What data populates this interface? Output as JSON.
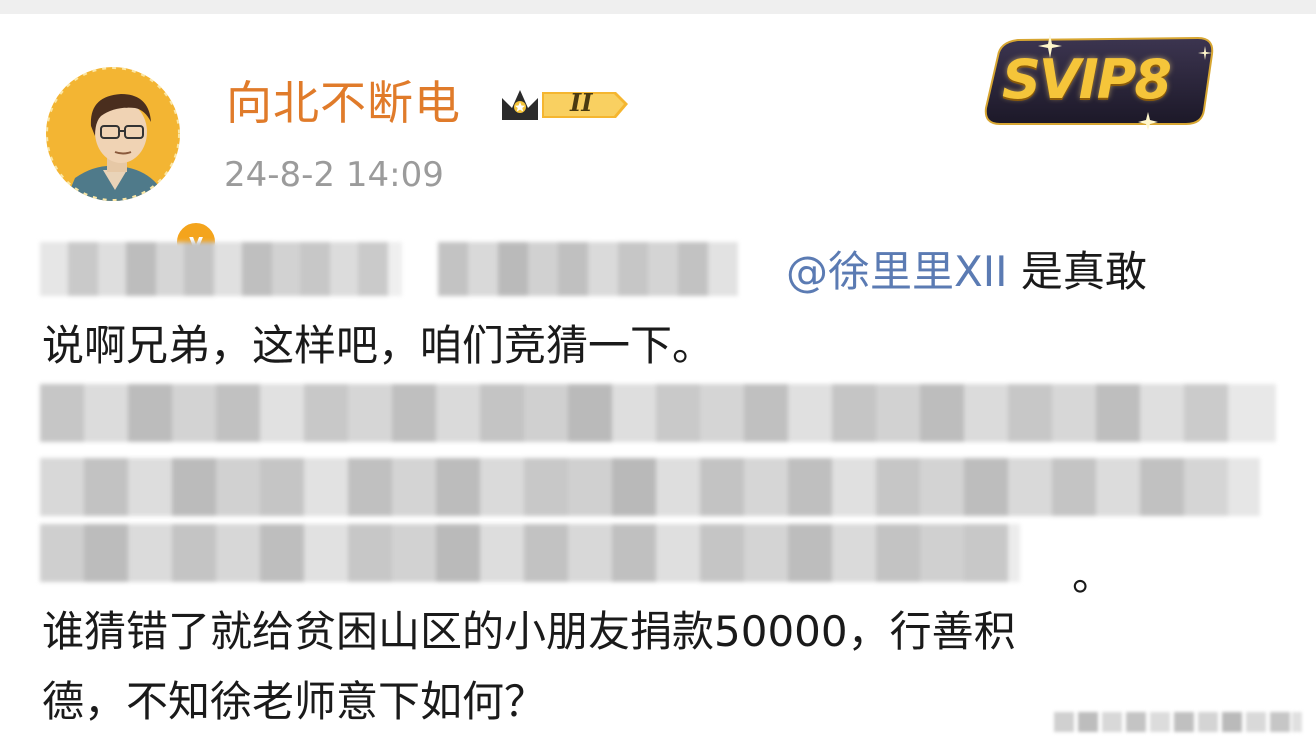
{
  "post": {
    "username": "向北不断电",
    "member_level": "II",
    "timestamp": "24-8-2 14:09",
    "svip_label": "SVIP8",
    "verified_mark": "v",
    "mention": "@徐里里XII",
    "line1_after_mention": " 是真敢",
    "line2": "说啊兄弟，这样吧，咱们竞猜一下。",
    "redacted_end": "。",
    "line6": "谁猜错了就给贫困山区的小朋友捐款50000，行善积",
    "line7": "德，不知徐老师意下如何？"
  },
  "colors": {
    "username": "#e07b2a",
    "timestamp": "#9b9b9b",
    "mention": "#5b7bb3",
    "body_text": "#1a1a1a",
    "verified_badge": "#f4a41c",
    "svip_gold": "#f5c53a",
    "svip_dark": "#2a2438"
  },
  "icons": {
    "avatar": "cartoon-man-avatar",
    "verified": "verified-v-icon",
    "member": "crown-badge-icon",
    "svip": "svip-badge-icon"
  }
}
